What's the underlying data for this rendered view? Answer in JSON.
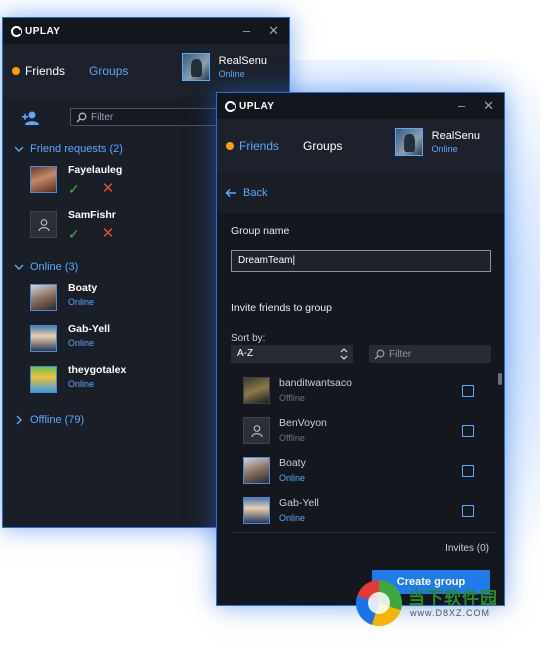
{
  "brand": "UPLAY",
  "user": {
    "name": "RealSenu",
    "status": "Online"
  },
  "friends_window": {
    "tabs": {
      "friends": "Friends",
      "groups": "Groups"
    },
    "filter_placeholder": "Filter",
    "friend_requests": {
      "title": "Friend requests (2)",
      "items": [
        {
          "name": "Fayelauleg"
        },
        {
          "name": "SamFishr"
        }
      ]
    },
    "online": {
      "title": "Online (3)",
      "items": [
        {
          "name": "Boaty",
          "status": "Online"
        },
        {
          "name": "Gab-Yell",
          "status": "Online"
        },
        {
          "name": "theygotalex",
          "status": "Online"
        }
      ]
    },
    "offline": {
      "title": "Offline (79)"
    }
  },
  "group_window": {
    "tabs": {
      "friends": "Friends",
      "groups": "Groups"
    },
    "back_label": "Back",
    "group_name_label": "Group name",
    "group_name_value": "DreamTeam",
    "invite_label": "Invite friends to group",
    "sort_label": "Sort by:",
    "sort_value": "A-Z",
    "filter_placeholder": "Filter",
    "invite_list": [
      {
        "name": "banditwantsaco",
        "status": "Offline"
      },
      {
        "name": "BenVoyon",
        "status": "Offline"
      },
      {
        "name": "Boaty",
        "status": "Online"
      },
      {
        "name": "Gab-Yell",
        "status": "Online"
      }
    ],
    "invites_count": "Invites (0)",
    "create_button": "Create group"
  },
  "watermark": {
    "text": "当下软件园",
    "url": "www.D8XZ.COM"
  },
  "colors": {
    "accent": "#5aa9ff",
    "button": "#1e7be8",
    "online_dot": "#f5a20c",
    "accept": "#43b84a",
    "decline": "#e14b3c"
  }
}
